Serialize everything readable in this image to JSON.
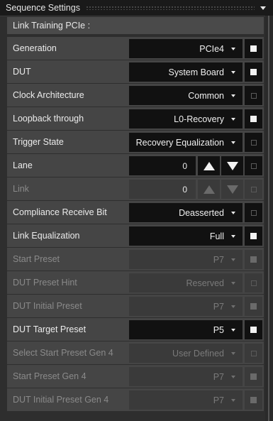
{
  "window": {
    "title": "Sequence Settings"
  },
  "section": {
    "title": "Link Training PCIe :"
  },
  "rows": [
    {
      "label": "Generation",
      "value": "PCIe4",
      "checked": "on",
      "enabled": true
    },
    {
      "label": "DUT",
      "value": "System Board",
      "checked": "on",
      "enabled": true
    },
    {
      "label": "Clock Architecture",
      "value": "Common",
      "checked": "off",
      "enabled": true
    },
    {
      "label": "Loopback through",
      "value": "L0-Recovery",
      "checked": "on",
      "enabled": true
    },
    {
      "label": "Trigger State",
      "value": "Recovery Equalization",
      "checked": "off",
      "enabled": true
    },
    {
      "label": "Lane",
      "value": "0",
      "checked": "off",
      "enabled": true,
      "spinner": true
    },
    {
      "label": "Link",
      "value": "0",
      "checked": "off",
      "enabled": false,
      "spinner": true
    },
    {
      "label": "Compliance Receive Bit",
      "value": "Deasserted",
      "checked": "off",
      "enabled": true
    },
    {
      "label": "Link Equalization",
      "value": "Full",
      "checked": "on",
      "enabled": true
    },
    {
      "label": "Start Preset",
      "value": "P7",
      "checked": "dim",
      "enabled": false
    },
    {
      "label": "DUT Preset Hint",
      "value": "Reserved",
      "checked": "off",
      "enabled": false
    },
    {
      "label": "DUT Initial Preset",
      "value": "P7",
      "checked": "dim",
      "enabled": false
    },
    {
      "label": "DUT Target Preset",
      "value": "P5",
      "checked": "on",
      "enabled": true
    },
    {
      "label": "Select Start Preset Gen 4",
      "value": "User Defined",
      "checked": "off",
      "enabled": false
    },
    {
      "label": "Start Preset Gen 4",
      "value": "P7",
      "checked": "dim",
      "enabled": false
    },
    {
      "label": "DUT Initial Preset Gen 4",
      "value": "P7",
      "checked": "dim",
      "enabled": false
    }
  ]
}
